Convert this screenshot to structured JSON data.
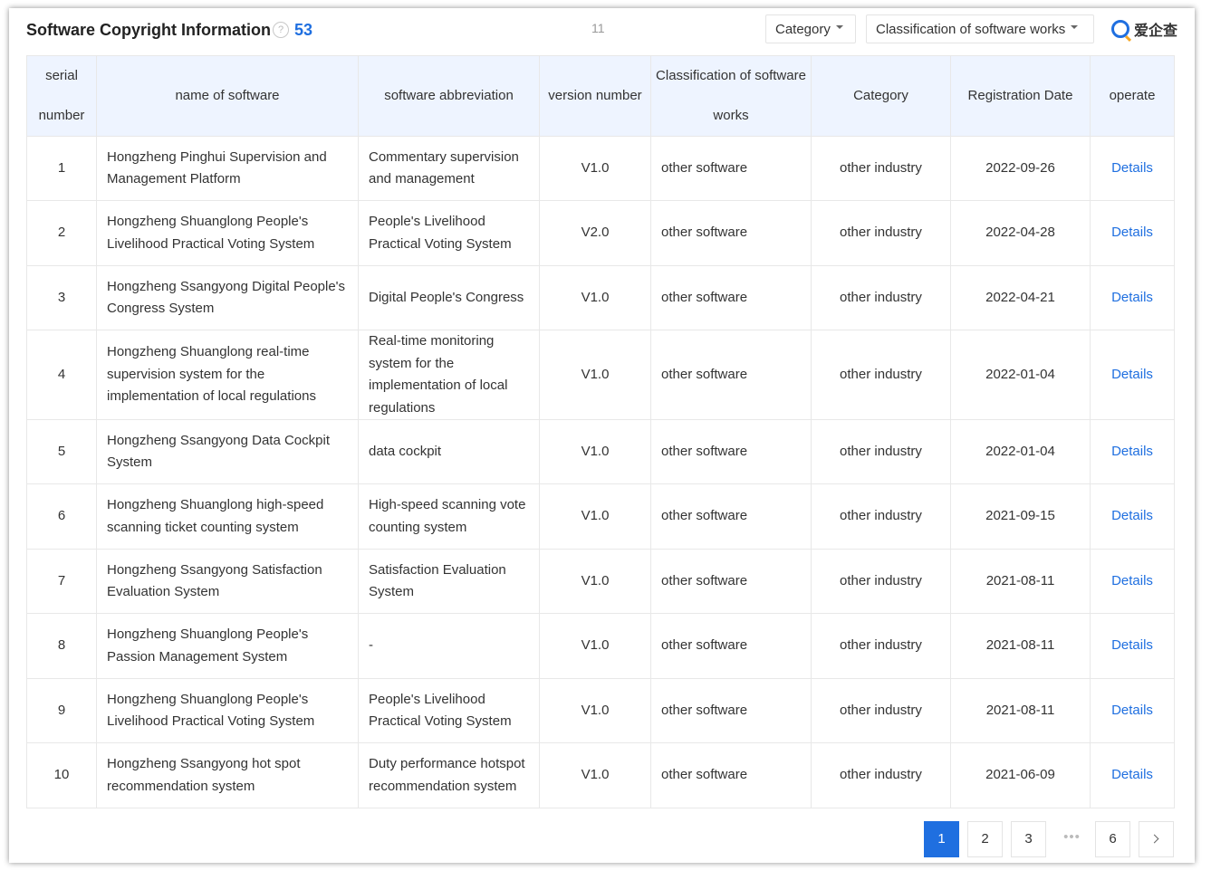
{
  "header": {
    "title": "Software Copyright Information",
    "help_glyph": "?",
    "count": "53",
    "top_page_indicator": "11",
    "filter_category": "Category",
    "filter_classification": "Classification of software works",
    "logo_text": "爱企查"
  },
  "table": {
    "columns": [
      "serial\nnumber",
      "name of software",
      "software abbreviation",
      "version number",
      "Classification of software works",
      "Category",
      "Registration Date",
      "operate"
    ],
    "rows": [
      {
        "serial": "1",
        "name": "Hongzheng Pinghui Supervision and Management Platform",
        "abbr": "Commentary supervision and management",
        "version": "V1.0",
        "classification": "other software",
        "category": "other industry",
        "date": "2022-09-26",
        "action": "Details"
      },
      {
        "serial": "2",
        "name": "Hongzheng Shuanglong People's Livelihood Practical Voting System",
        "abbr": "People's Livelihood Practical Voting System",
        "version": "V2.0",
        "classification": "other software",
        "category": "other industry",
        "date": "2022-04-28",
        "action": "Details"
      },
      {
        "serial": "3",
        "name": "Hongzheng Ssangyong Digital People's Congress System",
        "abbr": "Digital People's Congress",
        "version": "V1.0",
        "classification": "other software",
        "category": "other industry",
        "date": "2022-04-21",
        "action": "Details"
      },
      {
        "serial": "4",
        "name": "Hongzheng Shuanglong real-time supervision system for the implementation of local regulations",
        "abbr": "Real-time monitoring system for the implementation of local regulations",
        "version": "V1.0",
        "classification": "other software",
        "category": "other industry",
        "date": "2022-01-04",
        "action": "Details"
      },
      {
        "serial": "5",
        "name": "Hongzheng Ssangyong Data Cockpit System",
        "abbr": "data cockpit",
        "version": "V1.0",
        "classification": "other software",
        "category": "other industry",
        "date": "2022-01-04",
        "action": "Details"
      },
      {
        "serial": "6",
        "name": "Hongzheng Shuanglong high-speed scanning ticket counting system",
        "abbr": "High-speed scanning vote counting system",
        "version": "V1.0",
        "classification": "other software",
        "category": "other industry",
        "date": "2021-09-15",
        "action": "Details"
      },
      {
        "serial": "7",
        "name": "Hongzheng Ssangyong Satisfaction Evaluation System",
        "abbr": "Satisfaction Evaluation System",
        "version": "V1.0",
        "classification": "other software",
        "category": "other industry",
        "date": "2021-08-11",
        "action": "Details"
      },
      {
        "serial": "8",
        "name": "Hongzheng Shuanglong People's Passion Management System",
        "abbr": "-",
        "version": "V1.0",
        "classification": "other software",
        "category": "other industry",
        "date": "2021-08-11",
        "action": "Details"
      },
      {
        "serial": "9",
        "name": "Hongzheng Shuanglong People's Livelihood Practical Voting System",
        "abbr": "People's Livelihood Practical Voting System",
        "version": "V1.0",
        "classification": "other software",
        "category": "other industry",
        "date": "2021-08-11",
        "action": "Details"
      },
      {
        "serial": "10",
        "name": "Hongzheng Ssangyong hot spot recommendation system",
        "abbr": "Duty performance hotspot recommendation system",
        "version": "V1.0",
        "classification": "other software",
        "category": "other industry",
        "date": "2021-06-09",
        "action": "Details"
      }
    ]
  },
  "pagination": {
    "pages": [
      "1",
      "2",
      "3"
    ],
    "ellipsis": "•••",
    "last_page": "6",
    "current_page": "1"
  },
  "colors": {
    "accent": "#1f6fe0",
    "header_bg": "#eef4ff",
    "border": "#e8e8e8"
  }
}
